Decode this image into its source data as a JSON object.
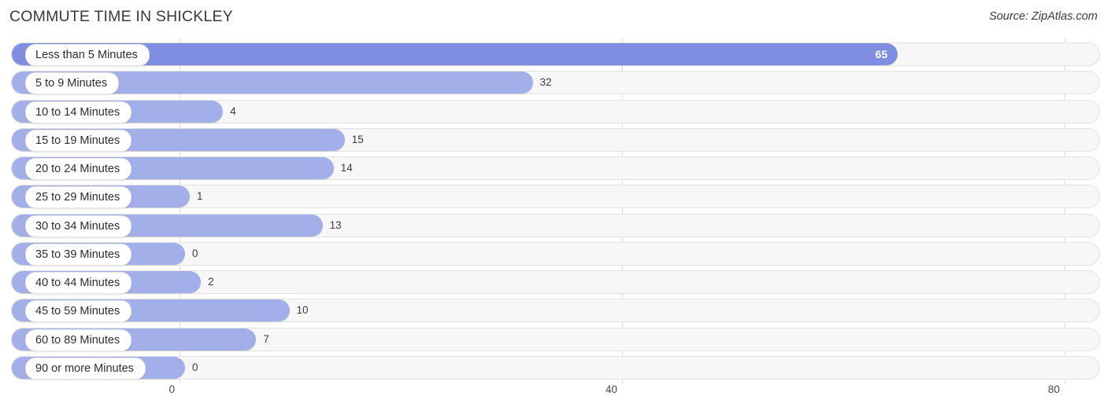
{
  "header": {
    "title": "COMMUTE TIME IN SHICKLEY",
    "source": "Source: ZipAtlas.com"
  },
  "chart_data": {
    "type": "bar",
    "orientation": "horizontal",
    "title": "COMMUTE TIME IN SHICKLEY",
    "subtitle": "Source: ZipAtlas.com",
    "xlabel": "",
    "ylabel": "",
    "xlim": [
      0,
      80
    ],
    "grid": true,
    "legend": false,
    "ticks": [
      "0",
      "40",
      "80"
    ],
    "tick_values": [
      0,
      40,
      80
    ],
    "categories": [
      "Less than 5 Minutes",
      "5 to 9 Minutes",
      "10 to 14 Minutes",
      "15 to 19 Minutes",
      "20 to 24 Minutes",
      "25 to 29 Minutes",
      "30 to 34 Minutes",
      "35 to 39 Minutes",
      "40 to 44 Minutes",
      "45 to 59 Minutes",
      "60 to 89 Minutes",
      "90 or more Minutes"
    ],
    "values": [
      65,
      32,
      4,
      15,
      14,
      1,
      13,
      0,
      2,
      10,
      7,
      0
    ],
    "value_labels": [
      "65",
      "32",
      "4",
      "15",
      "14",
      "1",
      "13",
      "0",
      "2",
      "10",
      "7",
      "0"
    ],
    "highlight_index": 0,
    "colors": {
      "bar": "#a3afe8",
      "bar_highlight": "#7f8ee0",
      "track": "#f7f7f7",
      "gridline": "#dddddd",
      "text": "#3c3c3c",
      "inside_label": "#ffffff"
    }
  }
}
